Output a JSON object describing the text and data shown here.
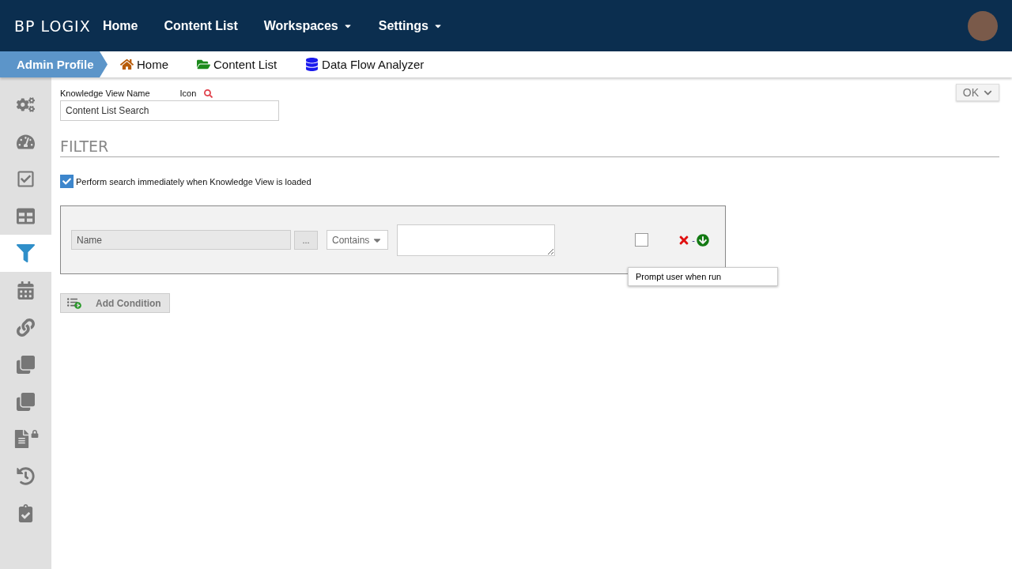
{
  "header": {
    "logo": "BP LOGIX",
    "nav": [
      {
        "label": "Home",
        "dropdown": false
      },
      {
        "label": "Content List",
        "dropdown": false
      },
      {
        "label": "Workspaces",
        "dropdown": true
      },
      {
        "label": "Settings",
        "dropdown": true
      }
    ]
  },
  "breadcrumb": {
    "current": "Admin Profile",
    "links": [
      {
        "kind": "home",
        "label": "Home"
      },
      {
        "kind": "folder",
        "label": "Content List"
      },
      {
        "kind": "database",
        "label": "Data Flow Analyzer"
      }
    ]
  },
  "sidebar": {
    "items": [
      {
        "kind": "gears",
        "selected": false
      },
      {
        "kind": "gauge",
        "selected": false
      },
      {
        "kind": "checkbox",
        "selected": false
      },
      {
        "kind": "table",
        "selected": false
      },
      {
        "kind": "filter",
        "selected": true
      },
      {
        "kind": "calendar",
        "selected": false
      },
      {
        "kind": "link",
        "selected": false
      },
      {
        "kind": "squares",
        "selected": false
      },
      {
        "kind": "copy",
        "selected": false
      },
      {
        "kind": "locked",
        "selected": false
      },
      {
        "kind": "history",
        "selected": false
      },
      {
        "kind": "clipboard",
        "selected": false
      }
    ]
  },
  "ok_button": "OK",
  "name_field": {
    "label": "Knowledge View Name",
    "icon_label": "Icon",
    "value": "Content List Search"
  },
  "section_title": "FILTER",
  "immediate_search": {
    "label": "Perform search immediately when Knowledge View is loaded",
    "checked": true
  },
  "conditions": [
    {
      "field": "Name",
      "picker": "...",
      "operator": "Contains",
      "prompt_checked": false,
      "tooltip": "Prompt user when run",
      "separator": "-"
    }
  ],
  "add_condition": "Add Condition"
}
